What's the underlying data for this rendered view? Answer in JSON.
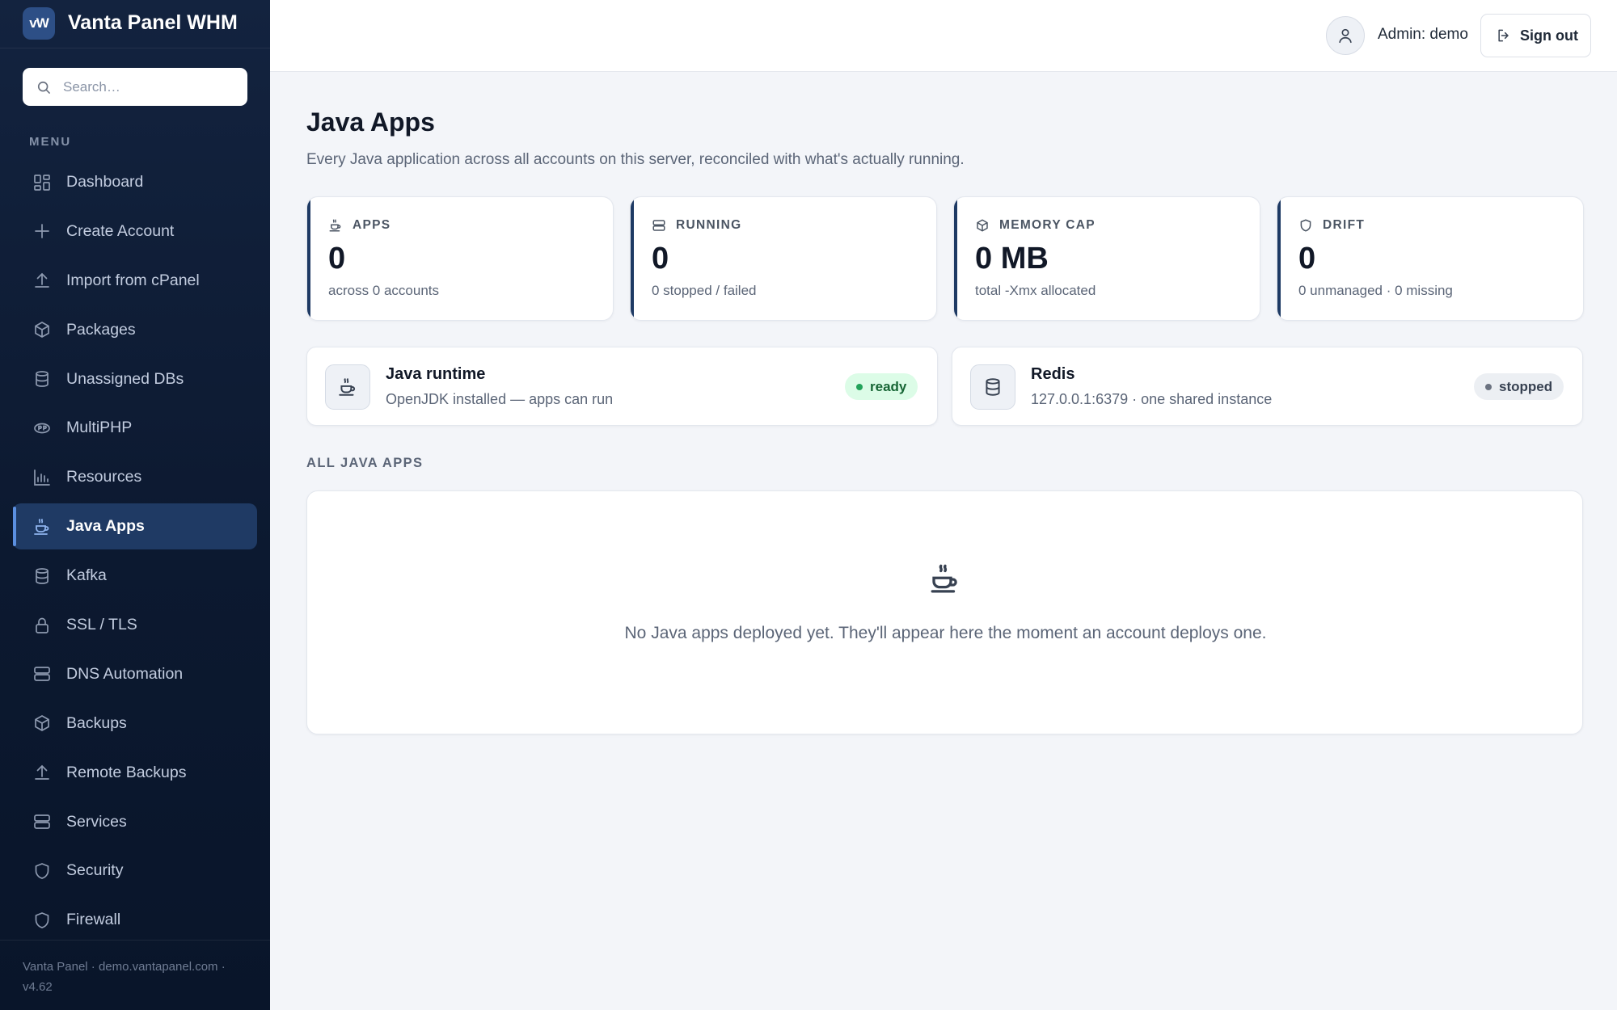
{
  "brand": {
    "logo_text": "vW",
    "name": "Vanta Panel WHM"
  },
  "search": {
    "placeholder": "Search…"
  },
  "menu_label": "MENU",
  "nav": [
    {
      "label": "Dashboard",
      "icon": "dashboard-icon",
      "active": false
    },
    {
      "label": "Create Account",
      "icon": "plus-icon",
      "active": false
    },
    {
      "label": "Import from cPanel",
      "icon": "upload-icon",
      "active": false
    },
    {
      "label": "Packages",
      "icon": "package-icon",
      "active": false
    },
    {
      "label": "Unassigned DBs",
      "icon": "database-icon",
      "active": false
    },
    {
      "label": "MultiPHP",
      "icon": "php-icon",
      "active": false
    },
    {
      "label": "Resources",
      "icon": "bar-chart-icon",
      "active": false
    },
    {
      "label": "Java Apps",
      "icon": "coffee-cup-icon",
      "active": true
    },
    {
      "label": "Kafka",
      "icon": "database-icon",
      "active": false
    },
    {
      "label": "SSL / TLS",
      "icon": "lock-icon",
      "active": false
    },
    {
      "label": "DNS Automation",
      "icon": "server-icon",
      "active": false
    },
    {
      "label": "Backups",
      "icon": "package-icon",
      "active": false
    },
    {
      "label": "Remote Backups",
      "icon": "upload-icon",
      "active": false
    },
    {
      "label": "Services",
      "icon": "server-icon",
      "active": false
    },
    {
      "label": "Security",
      "icon": "shield-icon",
      "active": false
    },
    {
      "label": "Firewall",
      "icon": "shield-icon",
      "active": false
    }
  ],
  "footer": {
    "text": "Vanta Panel · demo.vantapanel.com · v4.62"
  },
  "topbar": {
    "admin_label": "Admin: demo",
    "signout_label": "Sign out"
  },
  "page": {
    "title": "Java Apps",
    "subtitle": "Every Java application across all accounts on this server, reconciled with what's actually running."
  },
  "stats": [
    {
      "label": "APPS",
      "icon": "coffee-cup-icon",
      "value": "0",
      "note": "across 0 accounts"
    },
    {
      "label": "RUNNING",
      "icon": "server-icon",
      "value": "0",
      "note": "0 stopped / failed"
    },
    {
      "label": "MEMORY CAP",
      "icon": "package-icon",
      "value": "0 MB",
      "note": "total -Xmx allocated"
    },
    {
      "label": "DRIFT",
      "icon": "shield-icon",
      "value": "0",
      "note": "0 unmanaged · 0 missing"
    }
  ],
  "services": [
    {
      "name": "Java runtime",
      "desc": "OpenJDK installed — apps can run",
      "status": "ready",
      "icon": "coffee-cup-icon"
    },
    {
      "name": "Redis",
      "desc": "127.0.0.1:6379 · one shared instance",
      "status": "stopped",
      "icon": "database-icon"
    }
  ],
  "section_title": "ALL JAVA APPS",
  "empty": {
    "text": "No Java apps deployed yet. They'll appear here the moment an account deploys one."
  },
  "colors": {
    "sidebar": "#0c1930",
    "accent": "#1e3a64",
    "active_nav": "#1f3a64",
    "ready": "#dcfce7",
    "stopped": "#eceff3"
  }
}
